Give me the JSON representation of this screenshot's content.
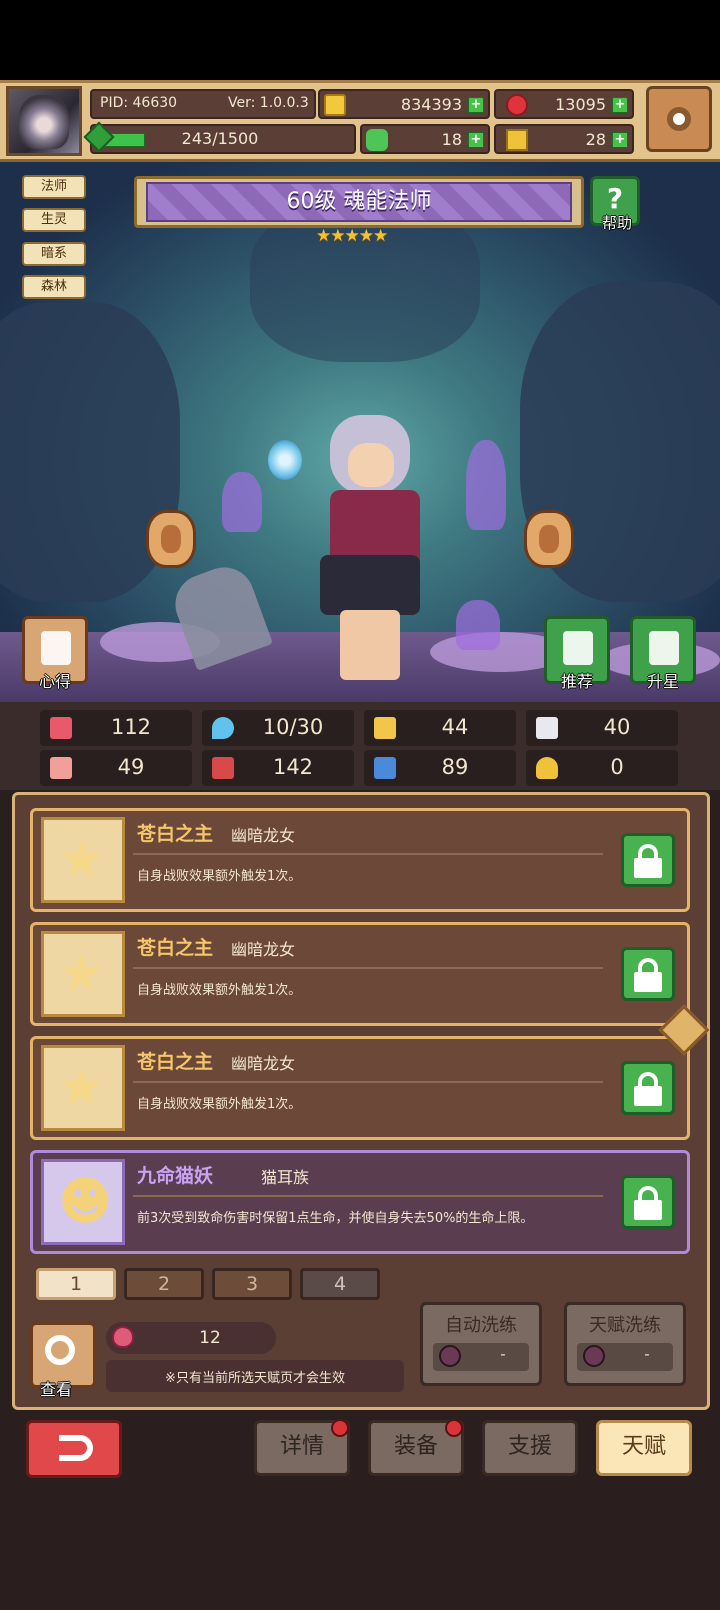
{
  "header": {
    "pid": "PID: 46630",
    "version": "Ver: 1.0.0.3",
    "xp": "243/1500",
    "xp_progress": 0.162,
    "gold": "834393",
    "ruby": "13095",
    "clover": "18",
    "key": "28",
    "plus": "+"
  },
  "tags": [
    "法师",
    "生灵",
    "暗系",
    "森林"
  ],
  "hero": {
    "title": "60级  魂能法师",
    "stars": "★★★★★",
    "star_count": 5,
    "help_icon": "?",
    "help_label": "帮助",
    "insight_label": "心得",
    "recommend_label": "推荐",
    "upgrade_label": "升星"
  },
  "stats": [
    {
      "icon": "heart-icon",
      "value": "112",
      "color": "#e85a6a"
    },
    {
      "icon": "mana-drop-icon",
      "value": "10/30",
      "color": "#62c2ee"
    },
    {
      "icon": "shield-icon",
      "value": "44",
      "color": "#f1c64a"
    },
    {
      "icon": "wing-icon",
      "value": "40",
      "color": "#e8e8f0"
    },
    {
      "icon": "fist-icon",
      "value": "49",
      "color": "#f0a098"
    },
    {
      "icon": "spellbook-icon",
      "value": "142",
      "color": "#d84a4a"
    },
    {
      "icon": "boot-icon",
      "value": "89",
      "color": "#4a8ad8"
    },
    {
      "icon": "horseshoe-icon",
      "value": "0",
      "color": "#f0c23a"
    }
  ],
  "talents": [
    {
      "name": "苍白之主",
      "source": "幽暗龙女",
      "desc": "自身战败效果额外触发1次。"
    },
    {
      "name": "苍白之主",
      "source": "幽暗龙女",
      "desc": "自身战败效果额外触发1次。"
    },
    {
      "name": "苍白之主",
      "source": "幽暗龙女",
      "desc": "自身战败效果额外触发1次。"
    },
    {
      "name": "九命猫妖",
      "source": "猫耳族",
      "desc": "前3次受到致命伤害时保留1点生命，并使自身失去50%的生命上限。"
    }
  ],
  "pages": [
    "1",
    "2",
    "3",
    "4"
  ],
  "bottom_panel": {
    "search_label": "查看",
    "potion_count": "12",
    "note": "※只有当前所选天赋页才会生效",
    "auto_wash": "自动洗练",
    "talent_wash": "天赋洗练",
    "wash_value": "-"
  },
  "nav": {
    "details": "详情",
    "equipment": "装备",
    "support": "支援",
    "talent": "天赋"
  }
}
